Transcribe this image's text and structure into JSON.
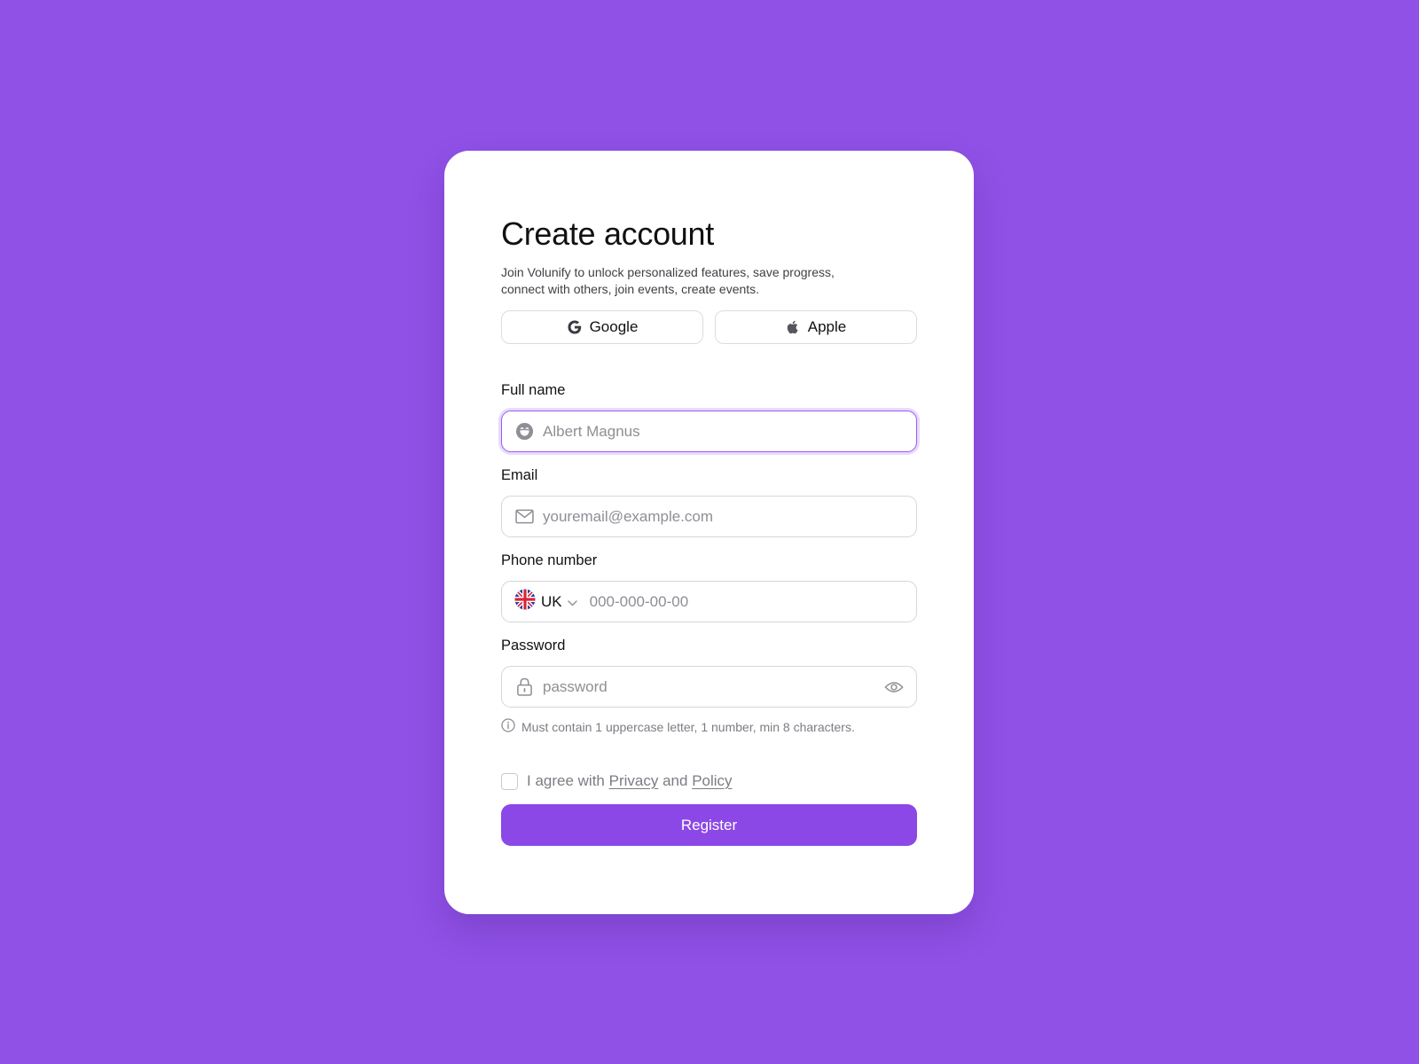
{
  "header": {
    "title": "Create account",
    "subtitle": "Join Volunify to unlock personalized features, save progress, connect with others, join events, create events."
  },
  "social": {
    "google_label": "Google",
    "apple_label": "Apple"
  },
  "form": {
    "full_name": {
      "label": "Full name",
      "placeholder": "Albert Magnus"
    },
    "email": {
      "label": "Email",
      "placeholder": "youremail@example.com"
    },
    "phone": {
      "label": "Phone number",
      "country": "UK",
      "placeholder": "000-000-00-00"
    },
    "password": {
      "label": "Password",
      "placeholder": "password",
      "hint": "Must contain 1 uppercase letter, 1 number, min 8 characters."
    }
  },
  "agreement": {
    "prefix": "I agree with",
    "privacy_link": "Privacy",
    "conjunction": "and",
    "policy_link": "Policy",
    "checked": false
  },
  "register_label": "Register",
  "colors": {
    "background": "#9051E6",
    "accent": "#8B48E6",
    "focus_border": "#9a5cf0"
  },
  "icons": [
    "google-icon",
    "apple-icon",
    "smiley-icon",
    "mail-icon",
    "uk-flag-icon",
    "chevron-down-icon",
    "lock-icon",
    "eye-icon",
    "info-icon"
  ]
}
